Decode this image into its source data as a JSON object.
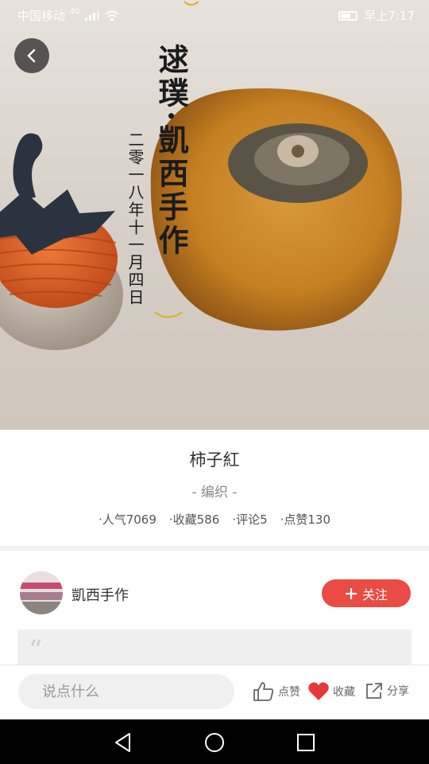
{
  "status_bar": {
    "carrier": "中国移动",
    "network": "4G",
    "time": "早上7:17"
  },
  "hero": {
    "calligraphy_main": "逑璞·凱西手作",
    "calligraphy_date": "二零一八年十一月四日"
  },
  "work": {
    "title": "柿子紅",
    "category": "- 编织 -"
  },
  "stats": {
    "popularity": "·人气7069",
    "favorites": "·收藏586",
    "comments": "·评论5",
    "likes": "·点赞130"
  },
  "author": {
    "name": "凱西手作",
    "follow_label": "关注",
    "quote_mark": "“"
  },
  "bottom_bar": {
    "comment_placeholder": "说点什么",
    "like_label": "点赞",
    "favorite_label": "收藏",
    "share_label": "分享"
  },
  "colors": {
    "accent": "#ea4b45",
    "heart": "#e5383b"
  },
  "icons": [
    "back-icon",
    "signal-icon",
    "wifi-icon",
    "battery-icon",
    "plus-icon",
    "thumb-up-icon",
    "heart-icon",
    "share-icon",
    "nav-back-icon",
    "nav-home-icon",
    "nav-recent-icon"
  ]
}
